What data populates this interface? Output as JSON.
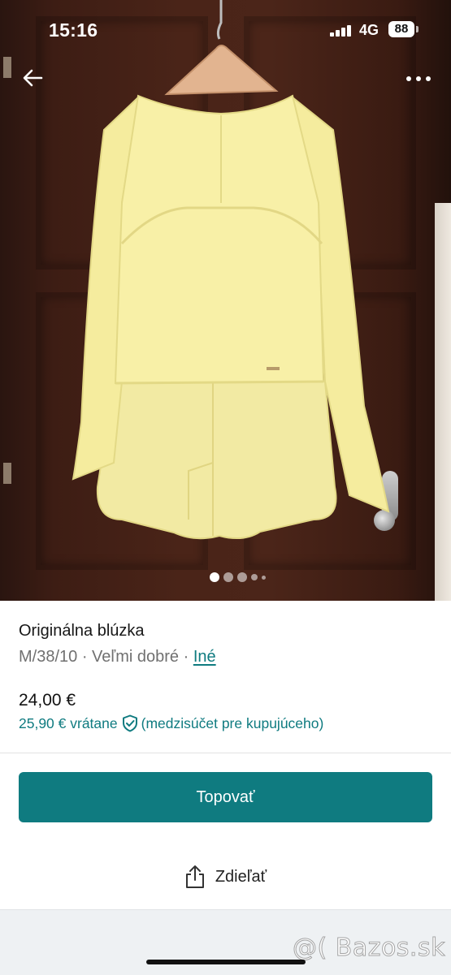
{
  "status_bar": {
    "time": "15:16",
    "network": "4G",
    "battery": "88"
  },
  "photo": {
    "subject": "yellow blouse on hanger",
    "page_count": 5,
    "active_index": 0
  },
  "nav": {
    "back_icon": "arrow-left-icon",
    "more_icon": "more-dots-icon"
  },
  "item": {
    "title": "Originálna blúzka",
    "meta_text": "M/38/10 · Veľmi dobré · ",
    "category_link": "Iné",
    "price": "24,00 €",
    "buyer_price": "25,90 € vrátane",
    "buyer_note": "(medzisúčet pre kupujúceho)"
  },
  "actions": {
    "topovat_label": "Topovať",
    "share_label": "Zdieľať"
  },
  "watermark": "@( Bazos.sk",
  "colors": {
    "accent": "#0f7b80",
    "meta_gray": "#707070",
    "bottom_band": "#eef1f3"
  }
}
